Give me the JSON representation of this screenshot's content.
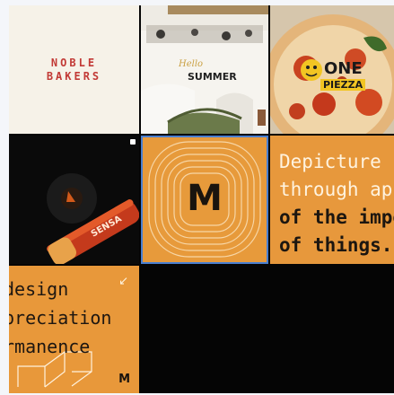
{
  "tiles": {
    "noble": {
      "line1": "NOBLE",
      "line2": "BAKERS"
    },
    "summer": {
      "script_text": "Hello",
      "headline": "SUMMER"
    },
    "pizza": {
      "brand_one": "ONE",
      "brand_pizza": "PIEZZA"
    },
    "sensa": {
      "product_label": "SENSA"
    },
    "monogram": {
      "letter": "M"
    },
    "statement": {
      "line1": "Depicture",
      "line2": "through ap",
      "line3": "of the impo",
      "line4": "of things."
    },
    "design": {
      "line1": "design",
      "line2": "preciation",
      "line3": "rmanence",
      "corner_mark": "M",
      "arrow": "↙"
    }
  },
  "colors": {
    "orange": "#e79a3b",
    "cream": "#f6f2e8",
    "brand_red": "#c23a36",
    "dark": "#050505",
    "selection_outline": "#4a7fd0"
  }
}
